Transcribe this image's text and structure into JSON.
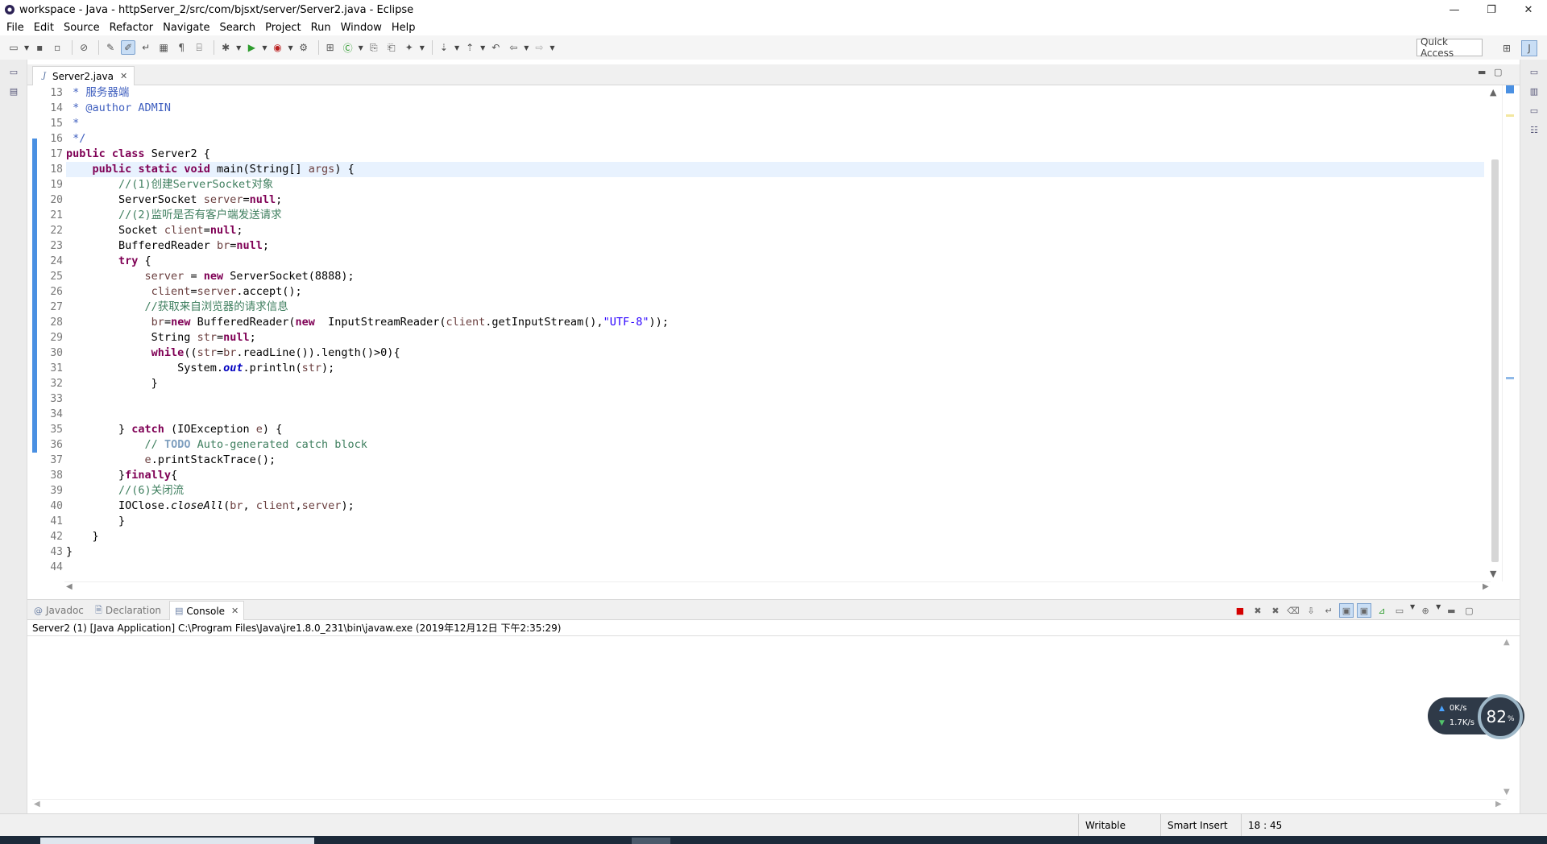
{
  "window": {
    "title": "workspace - Java - httpServer_2/src/com/bjsxt/server/Server2.java - Eclipse",
    "controls": {
      "minimize": "—",
      "maximize": "❐",
      "close": "✕"
    }
  },
  "menu": [
    "File",
    "Edit",
    "Source",
    "Refactor",
    "Navigate",
    "Search",
    "Project",
    "Run",
    "Window",
    "Help"
  ],
  "toolbar": {
    "quick_access_label": "Quick Access"
  },
  "editor": {
    "tab_label": "Server2.java",
    "tab_close": "✕",
    "current_line": 18,
    "lines": [
      {
        "n": 13,
        "html": " <span class=\"jd\">* 服务器端</span>"
      },
      {
        "n": 14,
        "html": " <span class=\"jd\">* @author ADMIN</span>"
      },
      {
        "n": 15,
        "html": " <span class=\"jd\">*</span>"
      },
      {
        "n": 16,
        "html": " <span class=\"jd\">*/</span>"
      },
      {
        "n": 17,
        "html": "<span class=\"kw\">public</span> <span class=\"kw\">class</span> Server2 {"
      },
      {
        "n": 18,
        "html": "    <span class=\"kw\">public</span> <span class=\"kw\">static</span> <span class=\"kw\">void</span> main(String[] <span class=\"lv\">args</span>) {"
      },
      {
        "n": 19,
        "html": "        <span class=\"cm\">//(1)创建ServerSocket对象</span>"
      },
      {
        "n": 20,
        "html": "        ServerSocket <span class=\"lv\">server</span>=<span class=\"kw\">null</span>;"
      },
      {
        "n": 21,
        "html": "        <span class=\"cm\">//(2)监听是否有客户端发送请求</span>"
      },
      {
        "n": 22,
        "html": "        Socket <span class=\"lv\">client</span>=<span class=\"kw\">null</span>;"
      },
      {
        "n": 23,
        "html": "        BufferedReader <span class=\"lv\">br</span>=<span class=\"kw\">null</span>;"
      },
      {
        "n": 24,
        "html": "        <span class=\"kw\">try</span> {"
      },
      {
        "n": 25,
        "html": "            <span class=\"lv\">server</span> = <span class=\"kw\">new</span> ServerSocket(8888);"
      },
      {
        "n": 26,
        "html": "             <span class=\"lv\">client</span>=<span class=\"lv\">server</span>.accept();"
      },
      {
        "n": 27,
        "html": "            <span class=\"cm\">//获取来自浏览器的请求信息</span>"
      },
      {
        "n": 28,
        "html": "             <span class=\"lv\">br</span>=<span class=\"kw\">new</span> BufferedReader(<span class=\"kw\">new</span>  InputStreamReader(<span class=\"lv\">client</span>.getInputStream(),<span class=\"st\">\"UTF-8\"</span>));"
      },
      {
        "n": 29,
        "html": "             String <span class=\"lv\">str</span>=<span class=\"kw\">null</span>;"
      },
      {
        "n": 30,
        "html": "             <span class=\"kw\">while</span>((<span class=\"lv\">str</span>=<span class=\"lv\">br</span>.readLine()).length()&gt;0){"
      },
      {
        "n": 31,
        "html": "                 System.<span class=\"fd\">out</span>.println(<span class=\"lv\">str</span>);"
      },
      {
        "n": 32,
        "html": "             }"
      },
      {
        "n": 33,
        "html": ""
      },
      {
        "n": 34,
        "html": ""
      },
      {
        "n": 35,
        "html": "        } <span class=\"kw\">catch</span> (IOException <span class=\"lv\">e</span>) {"
      },
      {
        "n": 36,
        "html": "            <span class=\"cm\">// </span><span class=\"todo\">TODO</span><span class=\"cm\"> Auto-generated catch block</span>"
      },
      {
        "n": 37,
        "html": "            <span class=\"lv\">e</span>.printStackTrace();"
      },
      {
        "n": 38,
        "html": "        }<span class=\"kw\">finally</span>{"
      },
      {
        "n": 39,
        "html": "        <span class=\"cm\">//(6)关闭流</span>"
      },
      {
        "n": 40,
        "html": "        IOClose.<span class=\"sf\">closeAll</span>(<span class=\"lv\">br</span>, <span class=\"lv\">client</span>,<span class=\"lv\">server</span>);"
      },
      {
        "n": 41,
        "html": "        }"
      },
      {
        "n": 42,
        "html": "    }"
      },
      {
        "n": 43,
        "html": "}"
      },
      {
        "n": 44,
        "html": ""
      }
    ]
  },
  "bottom_panel": {
    "tabs": [
      {
        "label": "Javadoc",
        "icon": "@",
        "active": false
      },
      {
        "label": "Declaration",
        "icon": "🗎",
        "active": false
      },
      {
        "label": "Console",
        "icon": "▤",
        "active": true
      }
    ],
    "console_description": "Server2 (1) [Java Application] C:\\Program Files\\Java\\jre1.8.0_231\\bin\\javaw.exe (2019年12月12日 下午2:35:29)"
  },
  "status_bar": {
    "writable": "Writable",
    "insert_mode": "Smart Insert",
    "position": "18 : 45"
  },
  "net_widget": {
    "upload": "0K/s",
    "download": "1.7K/s",
    "percent": "82",
    "percent_unit": "%"
  }
}
